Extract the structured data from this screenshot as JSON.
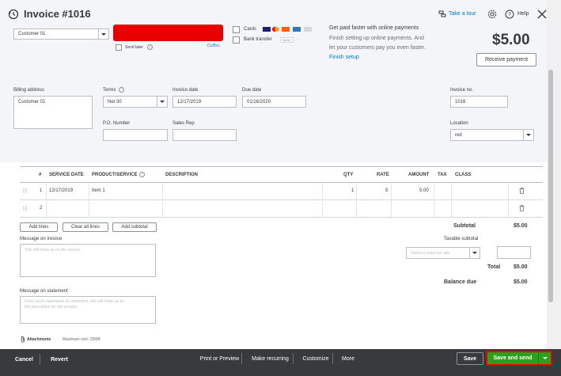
{
  "header": {
    "title": "Invoice #1016",
    "take_tour": "Take a tour",
    "help": "Help"
  },
  "customer": {
    "value": "Customer 01",
    "send_later": "Send later",
    "cc_bcc": "Cc/Bcc"
  },
  "payments": {
    "cards": "Cards",
    "bank_transfer": "Bank transfer",
    "bank_badge": "BANK",
    "promo_title": "Get paid faster with online payments",
    "promo_body_1": "Finish setting up online payments. And",
    "promo_body_2": "let your customers pay you even faster.",
    "finish_setup": "Finish setup"
  },
  "balance": {
    "amount": "$5.00",
    "receive_payment": "Receive payment"
  },
  "billing": {
    "address_label": "Billing address",
    "address_value": "Customer 01",
    "terms_label": "Terms",
    "terms_value": "Net 30",
    "invoice_date_label": "Invoice date",
    "invoice_date_value": "12/17/2019",
    "due_date_label": "Due date",
    "due_date_value": "01/16/2020",
    "po_label": "P.O. Number",
    "sales_rep_label": "Sales Rep",
    "invoice_no_label": "Invoice no.",
    "invoice_no_value": "1016",
    "location_label": "Location",
    "location_value": "red"
  },
  "table": {
    "headers": {
      "num": "#",
      "service_date": "SERVICE DATE",
      "product": "PRODUCT/SERVICE",
      "description": "DESCRIPTION",
      "qty": "QTY",
      "rate": "RATE",
      "amount": "AMOUNT",
      "tax": "TAX",
      "class": "CLASS"
    },
    "rows": [
      {
        "num": "1",
        "service_date": "12/17/2019",
        "product": "Item 1",
        "qty": "1",
        "rate": "5",
        "amount": "5.00"
      },
      {
        "num": "2",
        "service_date": "",
        "product": "",
        "qty": "",
        "rate": "",
        "amount": ""
      }
    ],
    "add_lines": "Add lines",
    "clear_all_lines": "Clear all lines",
    "add_subtotal": "Add subtotal"
  },
  "messages": {
    "invoice_label": "Message on invoice",
    "invoice_placeholder": "This will show up on the invoice.",
    "statement_label": "Message on statement",
    "statement_placeholder_1": "If you send statements to customers, this will show up as",
    "statement_placeholder_2": "the description for this invoice."
  },
  "attachments": {
    "label": "Attachments",
    "max_size": "Maximum size: 25MB"
  },
  "totals": {
    "subtotal_label": "Subtotal",
    "subtotal_value": "$5.00",
    "taxable_subtotal_label": "Taxable subtotal",
    "sales_tax_placeholder": "Select a sales tax rate",
    "total_label": "Total",
    "total_value": "$5.00",
    "balance_due_label": "Balance due",
    "balance_due_value": "$5.00"
  },
  "footer": {
    "cancel": "Cancel",
    "revert": "Revert",
    "print_preview": "Print or Preview",
    "make_recurring": "Make recurring",
    "customize": "Customize",
    "more": "More",
    "save": "Save",
    "save_and_send": "Save and send"
  },
  "colors": {
    "accent_green": "#2ca01c",
    "link_blue": "#0077c5",
    "redaction_red": "#e80000",
    "footer_bg": "#393a3d"
  }
}
